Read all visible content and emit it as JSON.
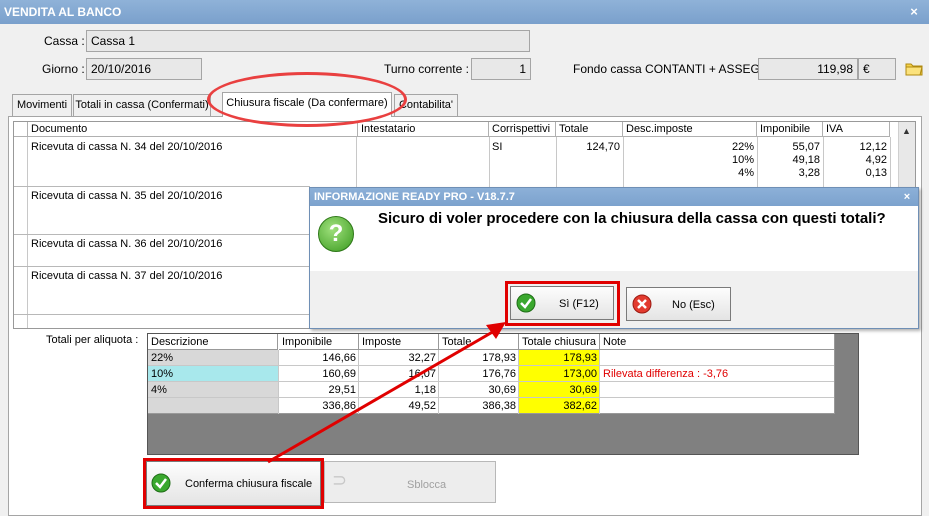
{
  "window": {
    "title": "VENDITA AL BANCO",
    "close_glyph": "×"
  },
  "header": {
    "cassa_label": "Cassa :",
    "cassa_value": "Cassa 1",
    "giorno_label": "Giorno :",
    "giorno_value": "20/10/2016",
    "turno_label": "Turno corrente :",
    "turno_value": "1",
    "fondo_label": "Fondo cassa CONTANTI + ASSEGNI :",
    "fondo_value": "119,98",
    "currency": "€"
  },
  "tabs": [
    "Movimenti",
    "Totali in cassa (Confermati)",
    "Chiusura fiscale (Da confermare)",
    "Contabilita'"
  ],
  "grid": {
    "columns": [
      "Documento",
      "Intestatario",
      "Corrispettivi",
      "Totale",
      "Desc.imposte",
      "Imponibile",
      "IVA"
    ],
    "rows": [
      {
        "documento": "Ricevuta di cassa N. 34 del 20/10/2016",
        "corrispettivi": "SI",
        "totale": "124,70",
        "aliquote": [
          "22%",
          "10%",
          "4%"
        ],
        "imponibili": [
          "55,07",
          "49,18",
          "3,28"
        ],
        "iva": [
          "12,12",
          "4,92",
          "0,13"
        ]
      },
      {
        "documento": "Ricevuta di cassa N. 35 del 20/10/2016"
      },
      {
        "documento": "Ricevuta di cassa N. 36 del 20/10/2016"
      },
      {
        "documento": "Ricevuta di cassa N. 37 del 20/10/2016"
      }
    ]
  },
  "totali": {
    "label": "Totali per aliquota :",
    "columns": [
      "Descrizione",
      "Imponibile",
      "Imposte",
      "Totale",
      "Totale chiusura",
      "Note"
    ],
    "rows": [
      {
        "descrizione": "22%",
        "imponibile": "146,66",
        "imposte": "32,27",
        "totale": "178,93",
        "totale_chiusura": "178,93",
        "note": ""
      },
      {
        "descrizione": "10%",
        "imponibile": "160,69",
        "imposte": "16,07",
        "totale": "176,76",
        "totale_chiusura": "173,00",
        "note": "Rilevata differenza : -3,76"
      },
      {
        "descrizione": "4%",
        "imponibile": "29,51",
        "imposte": "1,18",
        "totale": "30,69",
        "totale_chiusura": "30,69",
        "note": ""
      },
      {
        "descrizione": "",
        "imponibile": "336,86",
        "imposte": "49,52",
        "totale": "386,38",
        "totale_chiusura": "382,62",
        "note": ""
      }
    ]
  },
  "buttons": {
    "conferma": "Conferma chiusura fiscale",
    "sblocca": "Sblocca"
  },
  "dialog": {
    "title": "INFORMAZIONE READY PRO - V18.7.7",
    "close_glyph": "×",
    "message": "Sicuro di voler procedere con la chiusura della cassa con questi totali?",
    "yes_label": "Sì (F12)",
    "no_label": "No (Esc)",
    "question_glyph": "?"
  },
  "icons": {
    "folder": "folder-icon",
    "check": "check-icon",
    "cancel": "cancel-icon",
    "unlock": "unlock-icon"
  },
  "colors": {
    "highlight_red": "#e00000",
    "total_yellow": "#ffff00",
    "selected_row": "#a8e8ec",
    "titlebar": "#7ca2cd"
  }
}
